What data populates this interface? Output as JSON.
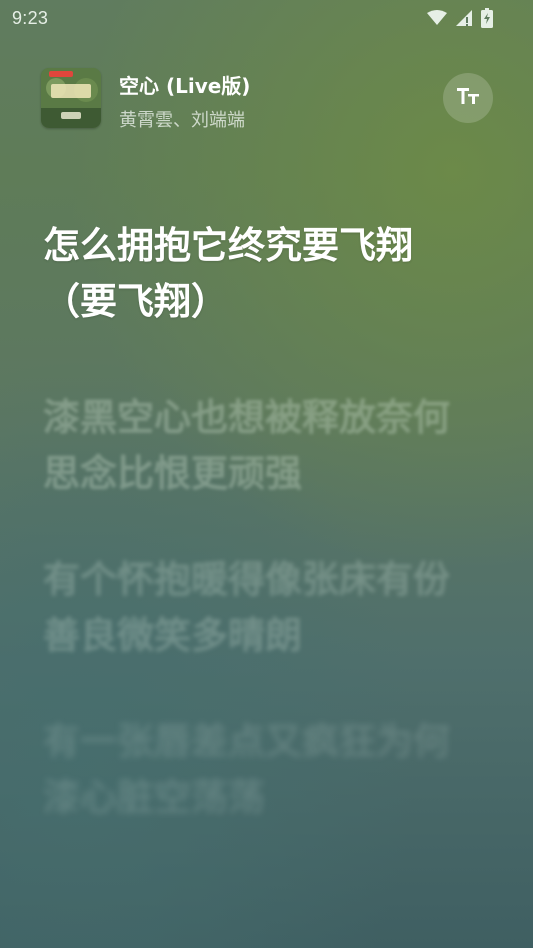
{
  "status_bar": {
    "time": "9:23",
    "icons": [
      "wifi-icon",
      "signal-icon",
      "battery-icon"
    ]
  },
  "song": {
    "title": "空心 (Live版)",
    "artist": "黄霄雲、刘端端",
    "album_art_icon": "album-cover"
  },
  "controls": {
    "text_size_icon": "text-size-icon",
    "text_size_glyph": "TT"
  },
  "lyrics": {
    "active": "怎么拥抱它终究要飞翔（要飞翔）",
    "lines": [
      "漆黑空心也想被释放奈何思念比恨更顽强",
      "有个怀抱暖得像张床有份善良微笑多晴朗",
      "有一张唇差点又疯狂为何漆心脏空荡荡"
    ]
  },
  "colors": {
    "active_lyric": "#ffffff",
    "inactive_lyric": "#d2e1d2"
  }
}
